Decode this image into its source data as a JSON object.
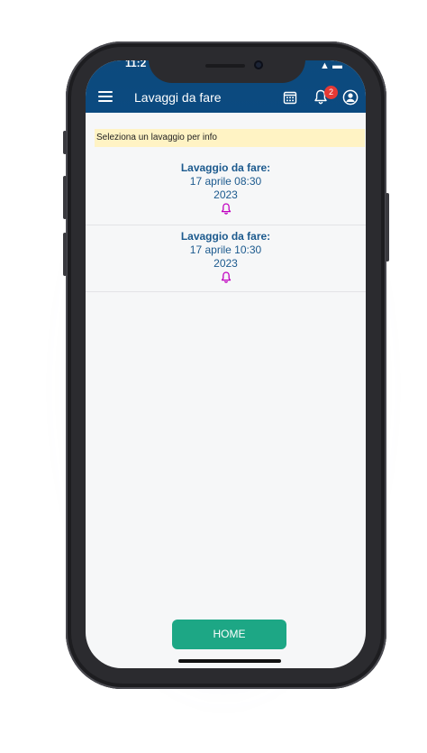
{
  "status": {
    "time": "11:2",
    "icons": "▲ ▬"
  },
  "appbar": {
    "title": "Lavaggi da fare",
    "notification_count": "2"
  },
  "info_banner": "Seleziona un lavaggio per info",
  "items": [
    {
      "title": "Lavaggio da fare:",
      "date": "17 aprile 08:30",
      "year": "2023"
    },
    {
      "title": "Lavaggio da fare:",
      "date": "17 aprile 10:30",
      "year": "2023"
    }
  ],
  "home_button": "HOME",
  "colors": {
    "appbar": "#0b4a80",
    "banner": "#fff3c4",
    "item_text": "#1c5a8e",
    "bell": "#c000c0",
    "home_button": "#1da785",
    "badge": "#e53935"
  }
}
